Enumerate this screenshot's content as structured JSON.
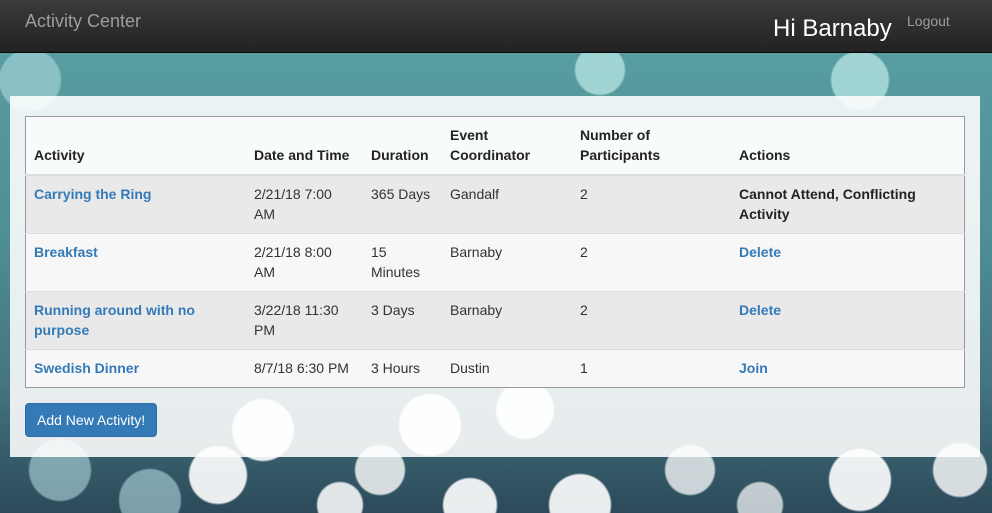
{
  "navbar": {
    "brand": "Activity Center",
    "greeting": "Hi Barnaby",
    "logout_label": "Logout"
  },
  "table": {
    "headers": {
      "activity": "Activity",
      "date_time": "Date and Time",
      "duration": "Duration",
      "coordinator": "Event Coordinator",
      "participants": "Number of Participants",
      "actions": "Actions"
    },
    "rows": [
      {
        "activity": "Carrying the Ring",
        "date_time": "2/21/18 7:00 AM",
        "duration": "365 Days",
        "coordinator": "Gandalf",
        "participants": "2",
        "action": "Cannot Attend, Conflicting Activity"
      },
      {
        "activity": "Breakfast",
        "date_time": "2/21/18 8:00 AM",
        "duration": "15 Minutes",
        "coordinator": "Barnaby",
        "participants": "2",
        "action": "Delete"
      },
      {
        "activity": "Running around with no purpose",
        "date_time": "3/22/18 11:30 PM",
        "duration": "3 Days",
        "coordinator": "Barnaby",
        "participants": "2",
        "action": "Delete"
      },
      {
        "activity": "Swedish Dinner",
        "date_time": "8/7/18 6:30 PM",
        "duration": "3 Hours",
        "coordinator": "Dustin",
        "participants": "1",
        "action": "Join"
      }
    ]
  },
  "add_button_label": "Add New Activity!",
  "colors": {
    "link": "#337ab7",
    "navbar": "#222222",
    "button": "#337ab7"
  }
}
